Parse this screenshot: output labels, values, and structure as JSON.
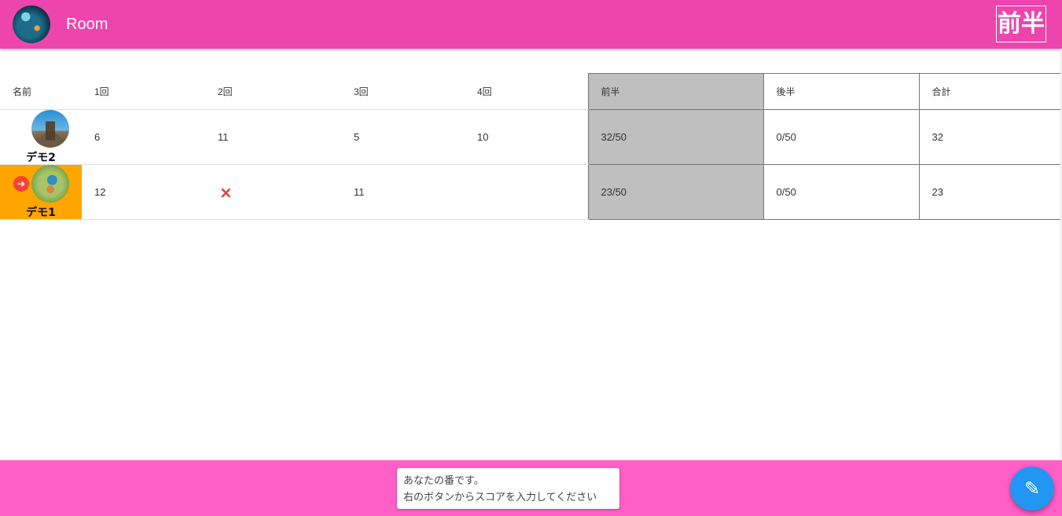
{
  "header": {
    "title": "Room",
    "avatar_icon": "room-avatar",
    "phase_label": "前半",
    "color": "#ee44ad"
  },
  "table": {
    "columns": [
      "名前",
      "1回",
      "2回",
      "3回",
      "4回",
      "前半",
      "後半",
      "合計"
    ],
    "rows": [
      {
        "name": "デモ2",
        "avatar_icon": "city-photo-avatar",
        "rounds": [
          "6",
          "11",
          "5",
          "10"
        ],
        "first_half": "32/50",
        "second_half": "0/50",
        "total": "32",
        "current_turn": false
      },
      {
        "name": "デモ1",
        "avatar_icon": "kingfisher-photo-avatar",
        "rounds": [
          "12",
          "",
          "11",
          ""
        ],
        "miss_icon": "×",
        "first_half": "23/50",
        "second_half": "0/50",
        "total": "23",
        "current_turn": true
      }
    ]
  },
  "footer": {
    "message_line1": "あなたの番です。",
    "message_line2": "右のボタンからスコアを入力してください",
    "edit_icon": "pencil-icon",
    "color": "#ff5fc6",
    "fab_color": "#2196f3",
    "active_row_color": "#ffa500"
  }
}
